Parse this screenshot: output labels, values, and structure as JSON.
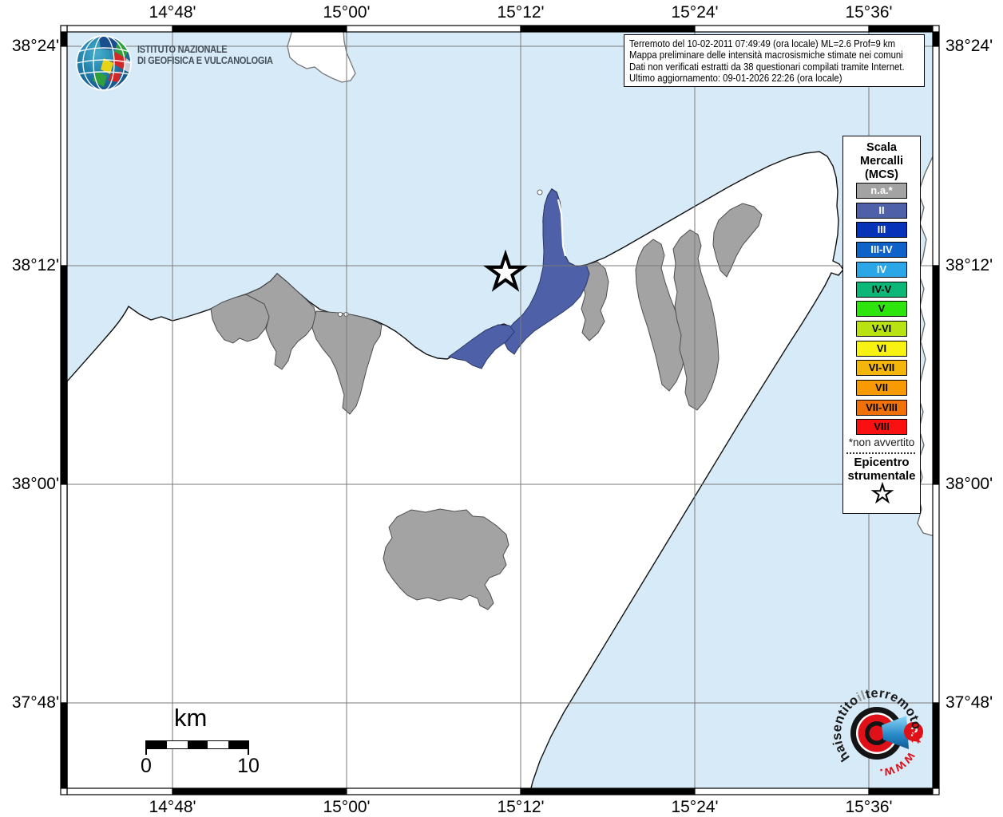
{
  "frame": {
    "axis_top": [
      "14°48'",
      "15°00'",
      "15°12'",
      "15°24'",
      "15°36'"
    ],
    "axis_bottom": [
      "14°48'",
      "15°00'",
      "15°12'",
      "15°24'",
      "15°36'"
    ],
    "axis_left": [
      "38°24'",
      "38°12'",
      "38°00'",
      "37°48'"
    ],
    "axis_right": [
      "38°24'",
      "38°12'",
      "38°00'",
      "37°48'"
    ]
  },
  "info_box": {
    "lines": [
      "Terremoto del 10-02-2011 07:49:49 (ora locale) ML=2.6 Prof=9 km",
      "Mappa preliminare delle intensità macrosismiche stimate nei comuni",
      "Dati non verificati estratti da 38 questionari compilati tramite Internet.",
      "Ultimo aggiornamento: 09-01-2026 22:26 (ora locale)"
    ]
  },
  "ingv_logo": {
    "line1": "ISTITUTO NAZIONALE",
    "line2": "DI GEOFISICA E VULCANOLOGIA"
  },
  "legend": {
    "title_lines": [
      "Scala",
      "Mercalli",
      "(MCS)"
    ],
    "items": [
      {
        "label": "n.a.*",
        "color": "#a3a3a3",
        "text": "#ffffff"
      },
      {
        "label": "II",
        "color": "#4d60a8",
        "text": "#ffffff"
      },
      {
        "label": "III",
        "color": "#0733b8",
        "text": "#ffffff"
      },
      {
        "label": "III-IV",
        "color": "#0f63c8",
        "text": "#ffffff"
      },
      {
        "label": "IV",
        "color": "#2ba7e8",
        "text": "#ffffff"
      },
      {
        "label": "IV-V",
        "color": "#0db778",
        "text": "#000000"
      },
      {
        "label": "V",
        "color": "#2de50d",
        "text": "#000000"
      },
      {
        "label": "V-VI",
        "color": "#b8e211",
        "text": "#000000"
      },
      {
        "label": "VI",
        "color": "#f7f212",
        "text": "#000000"
      },
      {
        "label": "VI-VII",
        "color": "#f4b60b",
        "text": "#000000"
      },
      {
        "label": "VII",
        "color": "#f89b03",
        "text": "#000000"
      },
      {
        "label": "VII-VIII",
        "color": "#ef7108",
        "text": "#000000"
      },
      {
        "label": "VIII",
        "color": "#fa1010",
        "text": "#000000"
      }
    ],
    "footnote": "*non avvertito",
    "epicenter_lines": [
      "Epicentro",
      "strumentale"
    ]
  },
  "scale_bar": {
    "unit": "km",
    "start_label": "0",
    "end_label": "10"
  },
  "watermark": {
    "arc_part1": "haisentito",
    "arc_part2": "il",
    "arc_part3": "terremoto",
    "arc_part4": ".it",
    "bottom": "www.",
    "badge": "?"
  },
  "map_colors": {
    "sea": "#d6eaf7",
    "land": "#ffffff",
    "na_municipality": "#a3a3a3",
    "intensity_ii_municipality": "#4d60a8",
    "grid": "#7a7a7a"
  }
}
